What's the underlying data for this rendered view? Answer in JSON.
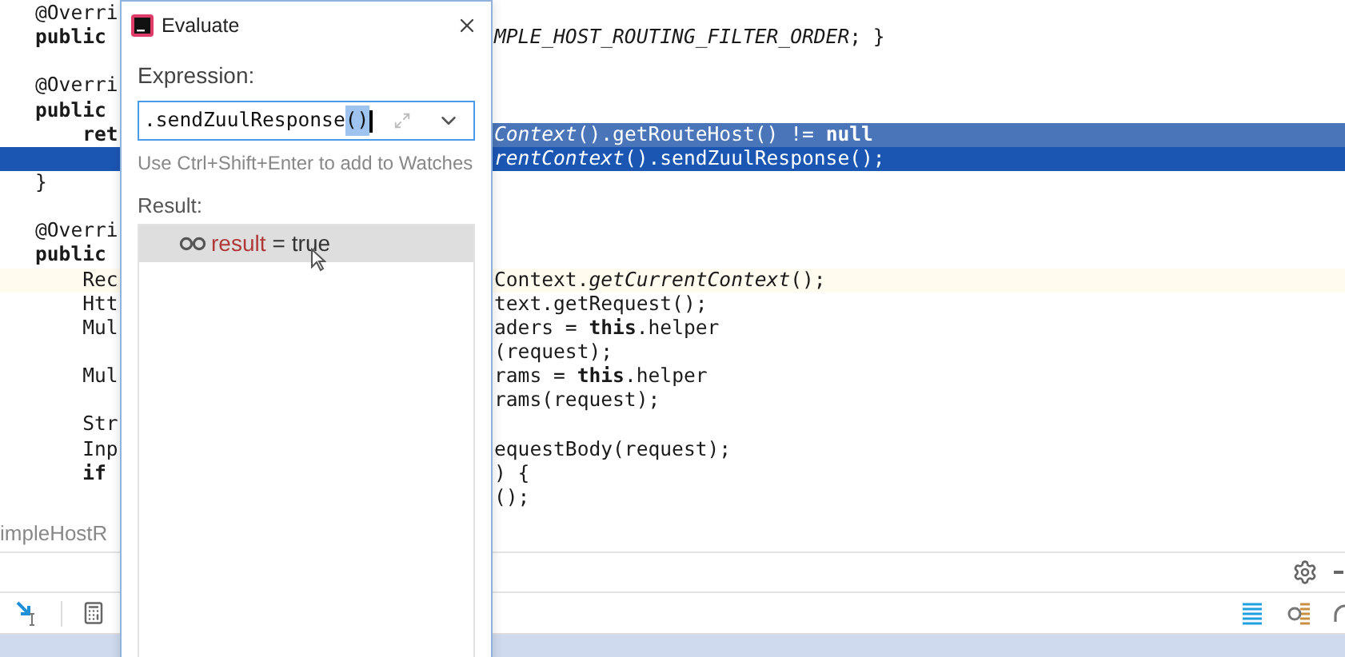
{
  "editor": {
    "lines": [
      {
        "left": "@Overri",
        "selected": false,
        "left_selected": false,
        "caret_line": false
      },
      {
        "left": "**public**",
        "right": "*MPLE_HOST_ROUTING_FILTER_ORDER*; }",
        "selected": false,
        "left_selected": false,
        "caret_line": false
      },
      {
        "selected": false,
        "left_selected": false,
        "caret_line": false
      },
      {
        "left": "@Overri",
        "selected": false,
        "left_selected": false,
        "caret_line": false
      },
      {
        "left": "**public**",
        "selected": false,
        "left_selected": false,
        "caret_line": false
      },
      {
        "left": "    **ret**",
        "right": "*Context*().getRouteHost() != **null**",
        "selected": true,
        "left_selected": false,
        "caret_line": false
      },
      {
        "right": "*rentContext*().sendZuulResponse();",
        "selected": true,
        "left_selected": true,
        "caret_line": false
      },
      {
        "left": "}",
        "selected": false,
        "left_selected": false,
        "caret_line": false
      },
      {
        "selected": false,
        "left_selected": false,
        "caret_line": false
      },
      {
        "left": "@Overri",
        "selected": false,
        "left_selected": false,
        "caret_line": false
      },
      {
        "left": "**public**",
        "selected": false,
        "left_selected": false,
        "caret_line": false
      },
      {
        "left": "    Rec",
        "right": "Context.*getCurrentContext*();",
        "selected": false,
        "left_selected": false,
        "caret_line": true
      },
      {
        "left": "    Htt",
        "right": "text.getRequest();",
        "selected": false,
        "left_selected": false,
        "caret_line": false
      },
      {
        "left": "    Mul",
        "right": "aders = **this**.helper",
        "selected": false,
        "left_selected": false,
        "caret_line": false
      },
      {
        "right": "(request);",
        "selected": false,
        "left_selected": false,
        "caret_line": false
      },
      {
        "left": "    Mul",
        "right": "rams = **this**.helper",
        "selected": false,
        "left_selected": false,
        "caret_line": false
      },
      {
        "right": "rams(request);",
        "selected": false,
        "left_selected": false,
        "caret_line": false
      },
      {
        "left": "    Str",
        "selected": false,
        "left_selected": false,
        "caret_line": false
      },
      {
        "left": "    Inp",
        "right": "equestBody(request);",
        "selected": false,
        "left_selected": false,
        "caret_line": false
      },
      {
        "left": "    **if**",
        "right": ") {",
        "selected": false,
        "left_selected": false,
        "caret_line": false
      },
      {
        "right": "();",
        "selected": false,
        "left_selected": false,
        "caret_line": false
      }
    ]
  },
  "file_tab": {
    "label": "impleHostR"
  },
  "dialog": {
    "title": "Evaluate",
    "expression_label": "Expression:",
    "expression": {
      "value": ".sendZuulResponse",
      "matched_braces": "()"
    },
    "hint": "Use Ctrl+Shift+Enter to add to Watches",
    "result_label": "Result:",
    "results": [
      {
        "name": "result",
        "operator": "=",
        "value": "true",
        "selected": true
      }
    ]
  }
}
